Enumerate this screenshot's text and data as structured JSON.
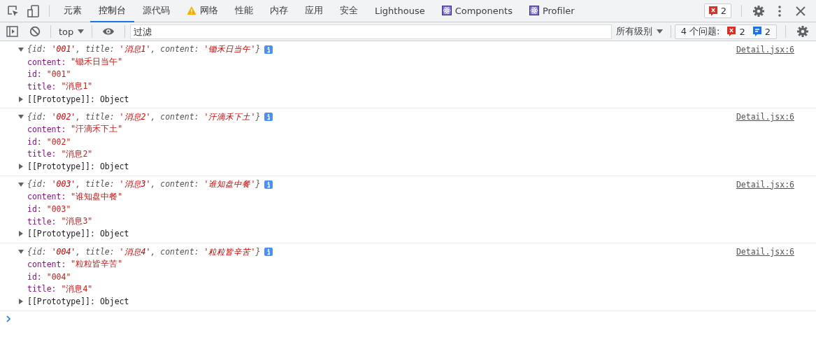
{
  "tabs": [
    {
      "label": "元素",
      "selected": false,
      "kind": "plain"
    },
    {
      "label": "控制台",
      "selected": true,
      "kind": "plain"
    },
    {
      "label": "源代码",
      "selected": false,
      "kind": "plain"
    },
    {
      "label": "网络",
      "selected": false,
      "kind": "warning"
    },
    {
      "label": "性能",
      "selected": false,
      "kind": "plain"
    },
    {
      "label": "内存",
      "selected": false,
      "kind": "plain"
    },
    {
      "label": "应用",
      "selected": false,
      "kind": "plain"
    },
    {
      "label": "安全",
      "selected": false,
      "kind": "plain"
    },
    {
      "label": "Lighthouse",
      "selected": false,
      "kind": "plain"
    },
    {
      "label": "Components",
      "selected": false,
      "kind": "react"
    },
    {
      "label": "Profiler",
      "selected": false,
      "kind": "react"
    }
  ],
  "error_badge": "2",
  "console_toolbar": {
    "context": "top",
    "filter": {
      "placeholder": "过滤"
    },
    "levels": "所有级别",
    "issues": {
      "label": "4 个问题:",
      "errors": "2",
      "info": "2"
    }
  },
  "entries": [
    {
      "expanded": true,
      "source": "Detail.jsx:6",
      "preview": [
        {
          "kind": "punct",
          "text": "{"
        },
        {
          "kind": "key",
          "text": "id: "
        },
        {
          "kind": "string",
          "text": "'001'"
        },
        {
          "kind": "punct",
          "text": ", "
        },
        {
          "kind": "key",
          "text": "title: "
        },
        {
          "kind": "string",
          "text": "'消息1'"
        },
        {
          "kind": "punct",
          "text": ", "
        },
        {
          "kind": "key",
          "text": "content: "
        },
        {
          "kind": "string",
          "text": "'锄禾日当午'"
        },
        {
          "kind": "punct",
          "text": "}"
        }
      ],
      "properties": [
        {
          "kind": "string",
          "key": "content:",
          "value": "\"锄禾日当午\""
        },
        {
          "kind": "string",
          "key": "id:",
          "value": "\"001\""
        },
        {
          "kind": "string",
          "key": "title:",
          "value": "\"消息1\""
        },
        {
          "kind": "object",
          "key": "[[Prototype]]:",
          "value": "Object",
          "expanded": false
        }
      ]
    },
    {
      "expanded": true,
      "source": "Detail.jsx:6",
      "preview": [
        {
          "kind": "punct",
          "text": "{"
        },
        {
          "kind": "key",
          "text": "id: "
        },
        {
          "kind": "string",
          "text": "'002'"
        },
        {
          "kind": "punct",
          "text": ", "
        },
        {
          "kind": "key",
          "text": "title: "
        },
        {
          "kind": "string",
          "text": "'消息2'"
        },
        {
          "kind": "punct",
          "text": ", "
        },
        {
          "kind": "key",
          "text": "content: "
        },
        {
          "kind": "string",
          "text": "'汗滴禾下土'"
        },
        {
          "kind": "punct",
          "text": "}"
        }
      ],
      "properties": [
        {
          "kind": "string",
          "key": "content:",
          "value": "\"汗滴禾下土\""
        },
        {
          "kind": "string",
          "key": "id:",
          "value": "\"002\""
        },
        {
          "kind": "string",
          "key": "title:",
          "value": "\"消息2\""
        },
        {
          "kind": "object",
          "key": "[[Prototype]]:",
          "value": "Object",
          "expanded": false
        }
      ]
    },
    {
      "expanded": true,
      "source": "Detail.jsx:6",
      "preview": [
        {
          "kind": "punct",
          "text": "{"
        },
        {
          "kind": "key",
          "text": "id: "
        },
        {
          "kind": "string",
          "text": "'003'"
        },
        {
          "kind": "punct",
          "text": ", "
        },
        {
          "kind": "key",
          "text": "title: "
        },
        {
          "kind": "string",
          "text": "'消息3'"
        },
        {
          "kind": "punct",
          "text": ", "
        },
        {
          "kind": "key",
          "text": "content: "
        },
        {
          "kind": "string",
          "text": "'谁知盘中餐'"
        },
        {
          "kind": "punct",
          "text": "}"
        }
      ],
      "properties": [
        {
          "kind": "string",
          "key": "content:",
          "value": "\"谁知盘中餐\""
        },
        {
          "kind": "string",
          "key": "id:",
          "value": "\"003\""
        },
        {
          "kind": "string",
          "key": "title:",
          "value": "\"消息3\""
        },
        {
          "kind": "object",
          "key": "[[Prototype]]:",
          "value": "Object",
          "expanded": false
        }
      ]
    },
    {
      "expanded": true,
      "source": "Detail.jsx:6",
      "preview": [
        {
          "kind": "punct",
          "text": "{"
        },
        {
          "kind": "key",
          "text": "id: "
        },
        {
          "kind": "string",
          "text": "'004'"
        },
        {
          "kind": "punct",
          "text": ", "
        },
        {
          "kind": "key",
          "text": "title: "
        },
        {
          "kind": "string",
          "text": "'消息4'"
        },
        {
          "kind": "punct",
          "text": ", "
        },
        {
          "kind": "key",
          "text": "content: "
        },
        {
          "kind": "string",
          "text": "'粒粒皆辛苦'"
        },
        {
          "kind": "punct",
          "text": "}"
        }
      ],
      "properties": [
        {
          "kind": "string",
          "key": "content:",
          "value": "\"粒粒皆辛苦\""
        },
        {
          "kind": "string",
          "key": "id:",
          "value": "\"004\""
        },
        {
          "kind": "string",
          "key": "title:",
          "value": "\"消息4\""
        },
        {
          "kind": "object",
          "key": "[[Prototype]]:",
          "value": "Object",
          "expanded": false
        }
      ]
    }
  ]
}
